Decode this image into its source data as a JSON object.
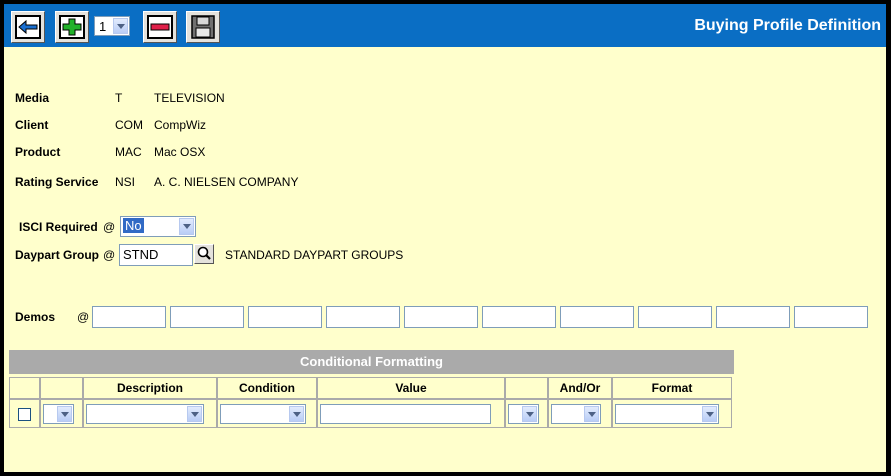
{
  "header": {
    "title": "Buying Profile Definition",
    "page_select_value": "1",
    "icons": [
      "back-arrow-icon",
      "add-icon",
      "delete-icon",
      "save-icon"
    ]
  },
  "fields": {
    "media": {
      "label": "Media",
      "code": "T",
      "name": "TELEVISION"
    },
    "client": {
      "label": "Client",
      "code": "COM",
      "name": "CompWiz"
    },
    "product": {
      "label": "Product",
      "code": "MAC",
      "name": "Mac OSX"
    },
    "rating_service": {
      "label": "Rating Service",
      "code": "NSI",
      "name": "A. C. NIELSEN COMPANY"
    },
    "isci_required": {
      "label": "ISCI Required",
      "at": "@",
      "value": "No"
    },
    "daypart_group": {
      "label": "Daypart Group",
      "at": "@",
      "value": "STND",
      "description": "STANDARD DAYPART GROUPS"
    }
  },
  "demos": {
    "label": "Demos",
    "at": "@",
    "values": [
      "",
      "",
      "",
      "",
      "",
      "",
      "",
      "",
      "",
      ""
    ]
  },
  "conditional_formatting": {
    "title": "Conditional Formatting",
    "columns": [
      "",
      "",
      "Description",
      "Condition",
      "Value",
      "",
      "And/Or",
      "Format"
    ]
  },
  "colors": {
    "toolbar": "#0a6ec4",
    "background": "#ffffcc",
    "header_gray": "#aaaaaa"
  }
}
